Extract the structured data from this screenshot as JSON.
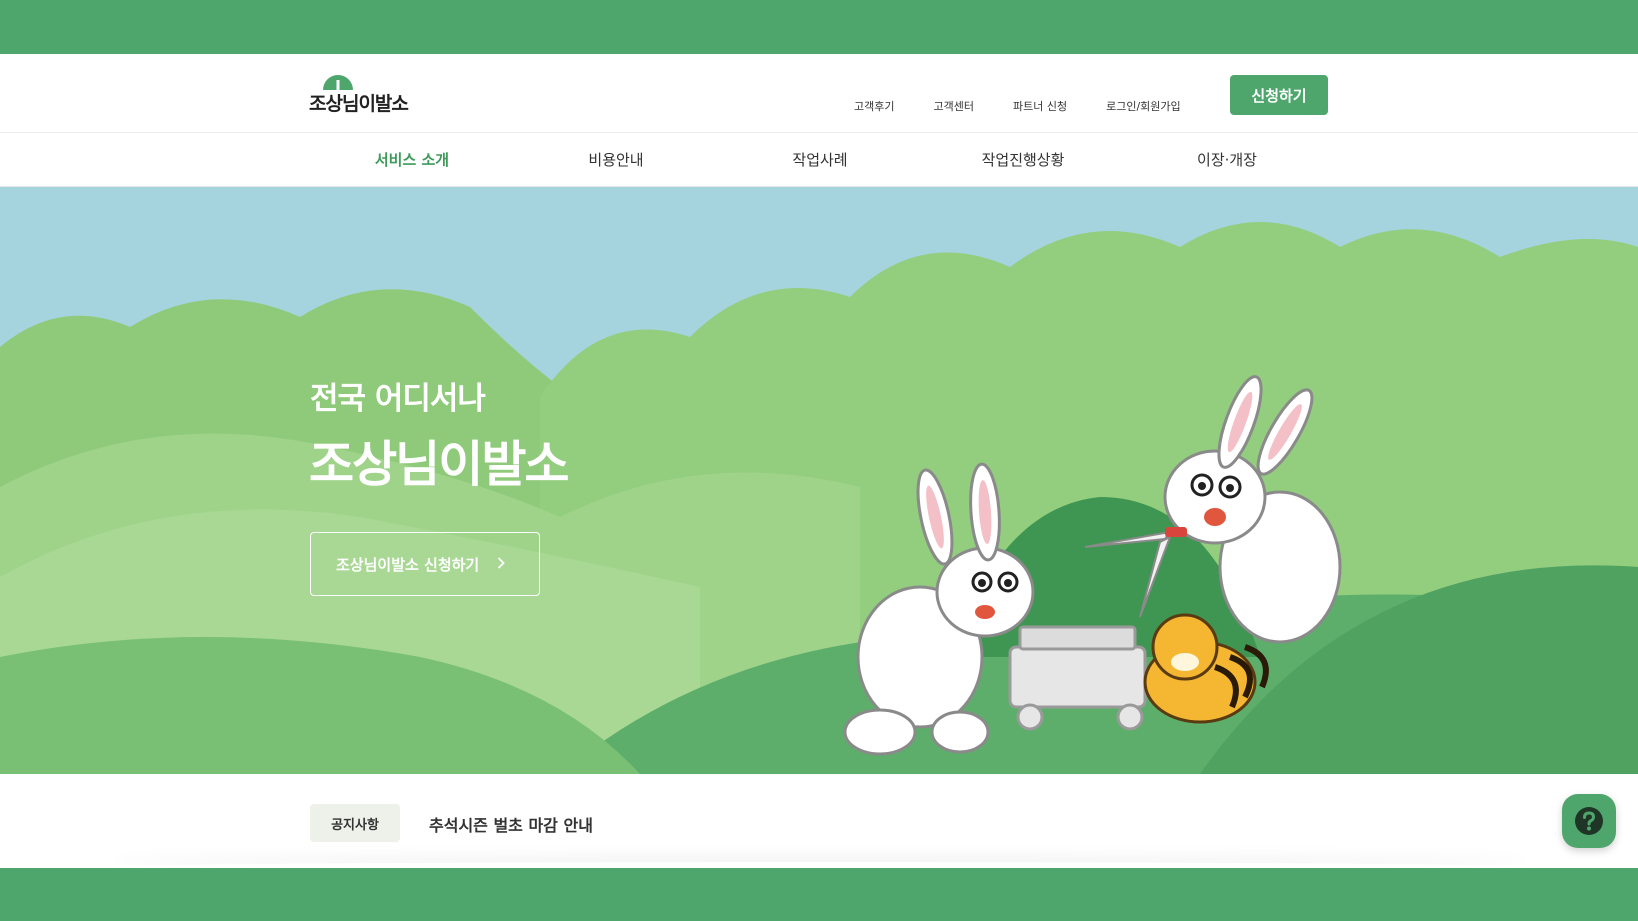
{
  "header": {
    "logo_text": "조상님이발소",
    "util_nav": [
      "고객후기",
      "고객센터",
      "파트너 신청",
      "로그인/회원가입"
    ],
    "cta_label": "신청하기"
  },
  "main_nav": {
    "items": [
      "서비스 소개",
      "비용안내",
      "작업사례",
      "작업진행상황",
      "이장·개장"
    ],
    "active": "서비스 소개"
  },
  "hero": {
    "subtitle": "전국 어디서나",
    "title": "조상님이발소",
    "button_label": "조상님이발소 신청하기",
    "button_icon": "chevron-right-icon"
  },
  "notice": {
    "badge": "공지사항",
    "text": "추석시즌 벌초 마감 안내"
  },
  "help": {
    "icon": "question-mark-icon"
  },
  "colors": {
    "brand_green": "#4ea66c",
    "active_nav": "#3f9a5c",
    "sky": "#9fd1dc",
    "hill_light": "#a6d58f",
    "hill_dark": "#55a866"
  }
}
